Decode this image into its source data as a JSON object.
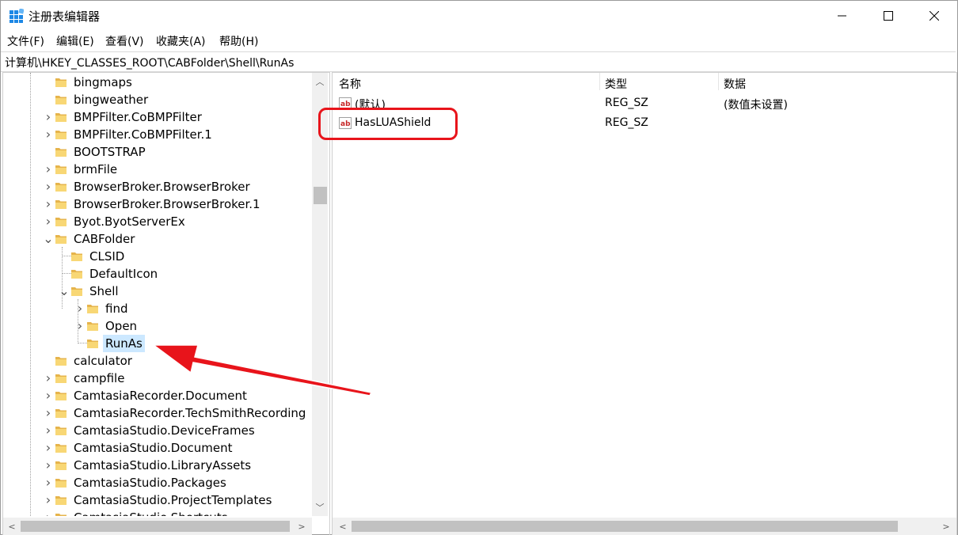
{
  "window": {
    "title": "注册表编辑器",
    "controls": {
      "minimize": "—",
      "maximize": "☐",
      "close": "✕"
    }
  },
  "menu": [
    "文件(F)",
    "编辑(E)",
    "查看(V)",
    "收藏夹(A)",
    "帮助(H)"
  ],
  "address": "计算机\\HKEY_CLASSES_ROOT\\CABFolder\\Shell\\RunAs",
  "tree": [
    {
      "label": "bingmaps",
      "level": 0,
      "expander": "none"
    },
    {
      "label": "bingweather",
      "level": 0,
      "expander": "none"
    },
    {
      "label": "BMPFilter.CoBMPFilter",
      "level": 0,
      "expander": "collapsed"
    },
    {
      "label": "BMPFilter.CoBMPFilter.1",
      "level": 0,
      "expander": "collapsed"
    },
    {
      "label": "BOOTSTRAP",
      "level": 0,
      "expander": "none"
    },
    {
      "label": "brmFile",
      "level": 0,
      "expander": "collapsed"
    },
    {
      "label": "BrowserBroker.BrowserBroker",
      "level": 0,
      "expander": "collapsed"
    },
    {
      "label": "BrowserBroker.BrowserBroker.1",
      "level": 0,
      "expander": "collapsed"
    },
    {
      "label": "Byot.ByotServerEx",
      "level": 0,
      "expander": "collapsed"
    },
    {
      "label": "CABFolder",
      "level": 0,
      "expander": "expanded"
    },
    {
      "label": "CLSID",
      "level": 1,
      "expander": "none"
    },
    {
      "label": "DefaultIcon",
      "level": 1,
      "expander": "none"
    },
    {
      "label": "Shell",
      "level": 1,
      "expander": "expanded"
    },
    {
      "label": "find",
      "level": 2,
      "expander": "collapsed"
    },
    {
      "label": "Open",
      "level": 2,
      "expander": "collapsed"
    },
    {
      "label": "RunAs",
      "level": 2,
      "expander": "none",
      "selected": true
    },
    {
      "label": "calculator",
      "level": 0,
      "expander": "none"
    },
    {
      "label": "campfile",
      "level": 0,
      "expander": "collapsed"
    },
    {
      "label": "CamtasiaRecorder.Document",
      "level": 0,
      "expander": "collapsed"
    },
    {
      "label": "CamtasiaRecorder.TechSmithRecording",
      "level": 0,
      "expander": "collapsed"
    },
    {
      "label": "CamtasiaStudio.DeviceFrames",
      "level": 0,
      "expander": "collapsed"
    },
    {
      "label": "CamtasiaStudio.Document",
      "level": 0,
      "expander": "collapsed"
    },
    {
      "label": "CamtasiaStudio.LibraryAssets",
      "level": 0,
      "expander": "collapsed"
    },
    {
      "label": "CamtasiaStudio.Packages",
      "level": 0,
      "expander": "collapsed"
    },
    {
      "label": "CamtasiaStudio.ProjectTemplates",
      "level": 0,
      "expander": "collapsed"
    },
    {
      "label": "CamtasiaStudio.Shortcuts",
      "level": 0,
      "expander": "collapsed"
    }
  ],
  "columns": {
    "name": "名称",
    "type": "类型",
    "data": "数据"
  },
  "values": [
    {
      "name": "(默认)",
      "type": "REG_SZ",
      "data": "(数值未设置)"
    },
    {
      "name": "HasLUAShield",
      "type": "REG_SZ",
      "data": ""
    }
  ],
  "annotation_color": "#e8141b",
  "icons": {
    "folder": "folder-icon",
    "value": "string-value-icon",
    "app": "regedit-icon"
  }
}
